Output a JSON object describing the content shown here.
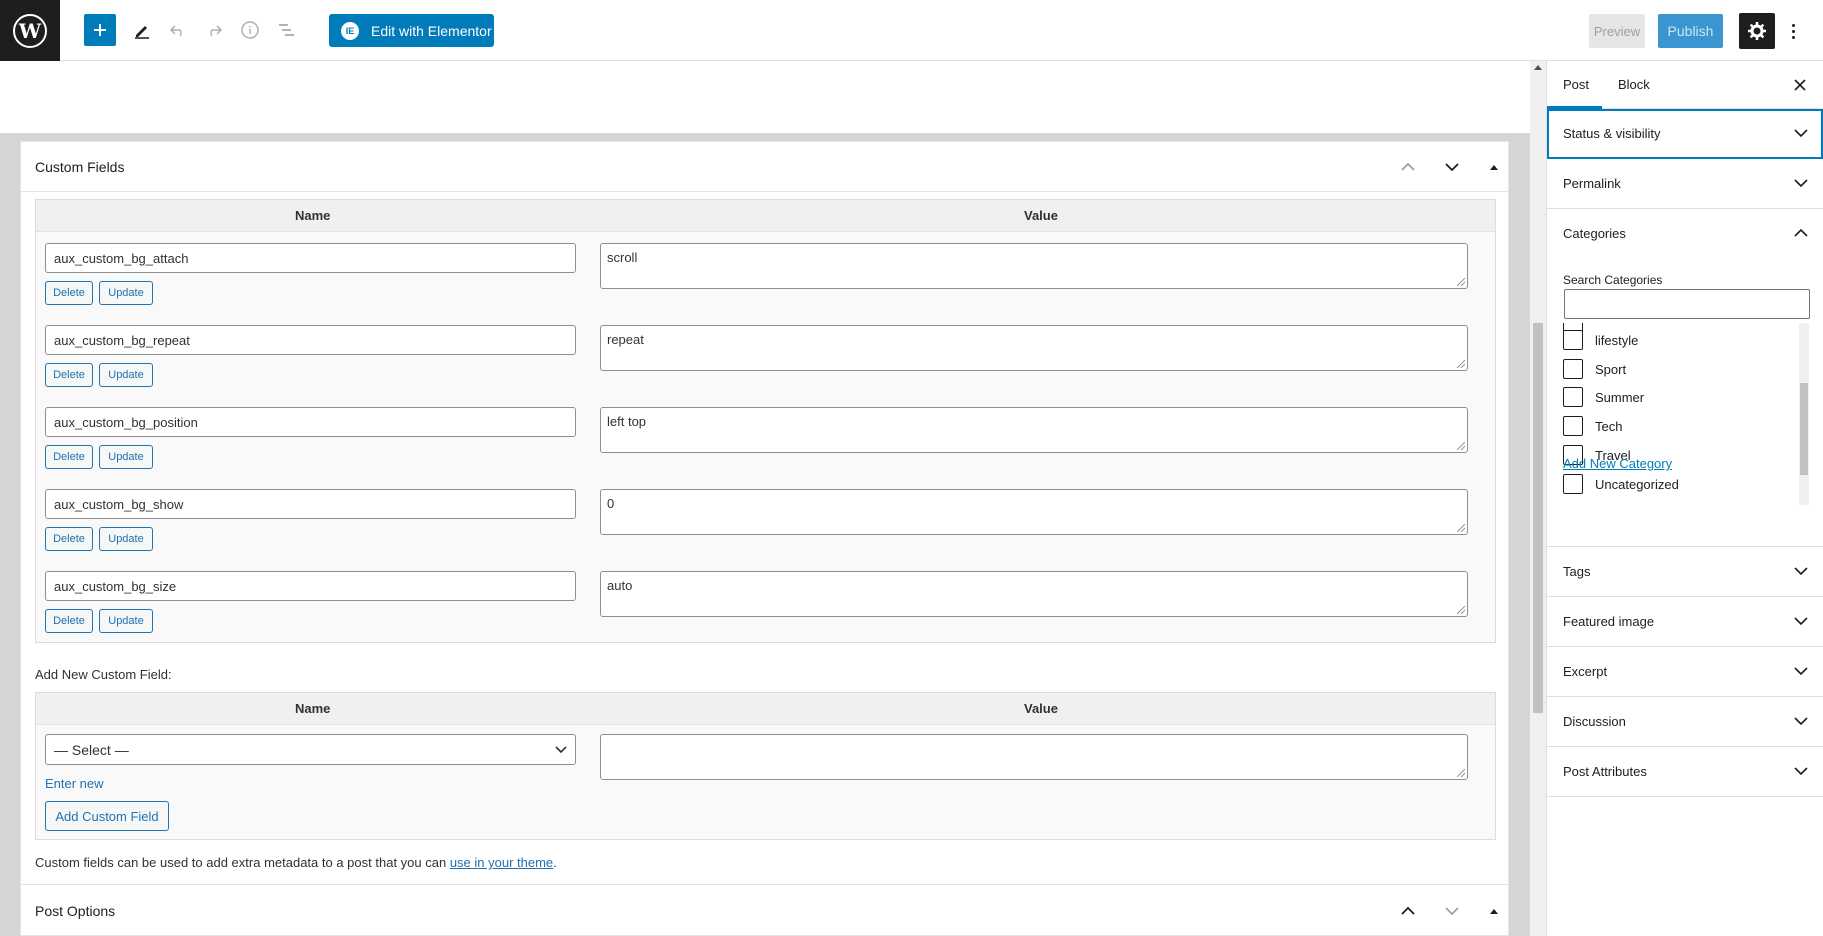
{
  "toolbar": {
    "elementor_label": "Edit with Elementor",
    "elementor_badge": "IE",
    "preview_label": "Preview",
    "publish_label": "Publish"
  },
  "custom_fields": {
    "title": "Custom Fields",
    "col_name": "Name",
    "col_value": "Value",
    "delete_label": "Delete",
    "update_label": "Update",
    "rows": [
      {
        "name": "aux_custom_bg_attach",
        "value": "scroll"
      },
      {
        "name": "aux_custom_bg_repeat",
        "value": "repeat"
      },
      {
        "name": "aux_custom_bg_position",
        "value": "left top"
      },
      {
        "name": "aux_custom_bg_show",
        "value": "0"
      },
      {
        "name": "aux_custom_bg_size",
        "value": "auto"
      }
    ],
    "add_new_label": "Add New Custom Field:",
    "select_placeholder": "— Select —",
    "enter_new": "Enter new",
    "add_button": "Add Custom Field",
    "hint_prefix": "Custom fields can be used to add extra metadata to a post that you can ",
    "hint_link": "use in your theme",
    "hint_suffix": "."
  },
  "post_options": {
    "title": "Post Options"
  },
  "sidebar": {
    "tab_post": "Post",
    "tab_block": "Block",
    "sections": {
      "status": "Status & visibility",
      "permalink": "Permalink",
      "categories": "Categories",
      "tags": "Tags",
      "featured": "Featured image",
      "excerpt": "Excerpt",
      "discussion": "Discussion",
      "attributes": "Post Attributes"
    },
    "search_categories_label": "Search Categories",
    "categories": [
      "lifestyle",
      "Sport",
      "Summer",
      "Tech",
      "Travel",
      "Uncategorized"
    ],
    "add_new_category": "Add New Category"
  },
  "colors": {
    "accent": "#007cba",
    "wp_dark": "#1e1e1e",
    "link": "#2271b1"
  }
}
